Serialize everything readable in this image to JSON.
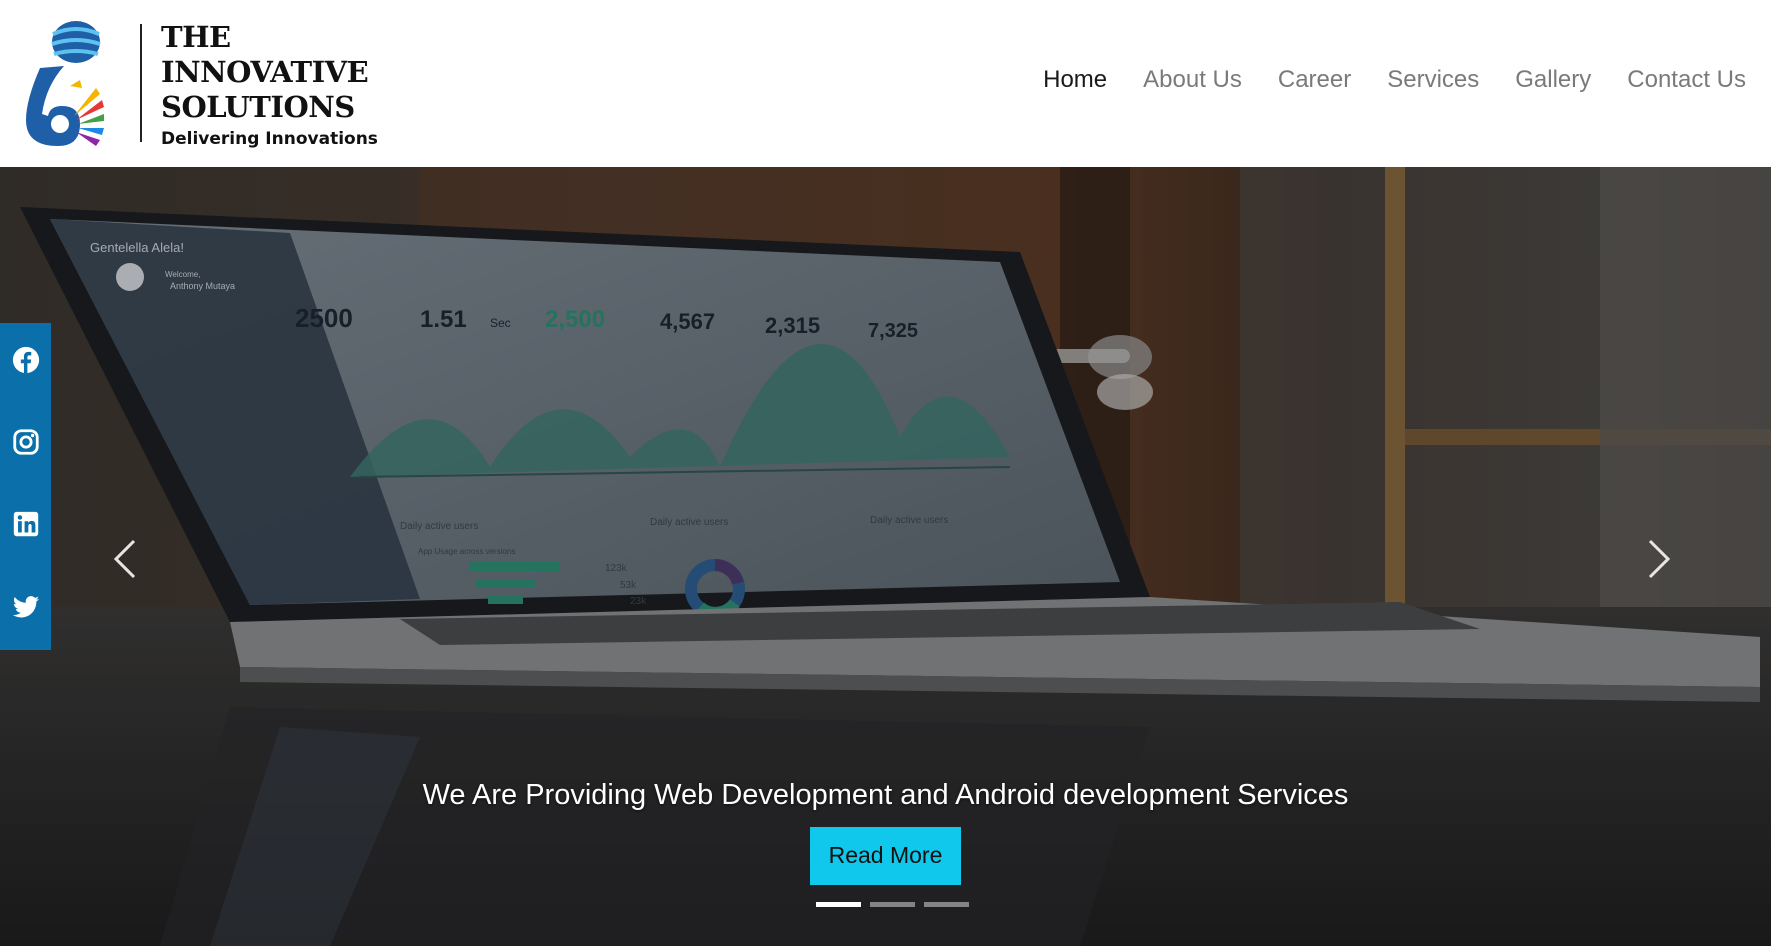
{
  "brand": {
    "name_lines": [
      "THE",
      "INNOVATIVE",
      "SOLUTIONS"
    ],
    "tagline": "Delivering Innovations",
    "logo_icon": "globe-peacock-logo-icon"
  },
  "nav": {
    "items": [
      {
        "label": "Home",
        "active": true
      },
      {
        "label": "About Us",
        "active": false
      },
      {
        "label": "Career",
        "active": false
      },
      {
        "label": "Services",
        "active": false
      },
      {
        "label": "Gallery",
        "active": false
      },
      {
        "label": "Contact Us",
        "active": false
      }
    ]
  },
  "hero": {
    "caption": "We Are Providing Web Development and Android development Services",
    "cta_label": "Read More",
    "slide_count": 3,
    "active_slide": 1,
    "prev_icon": "chevron-left-icon",
    "next_icon": "chevron-right-icon",
    "dashboard": {
      "brand": "Gentelella Alela!",
      "user_greeting": "Welcome,",
      "user_name": "Anthony Mutaya",
      "stats": [
        "2500",
        "1.51",
        "2,500",
        "4,567",
        "2,315",
        "7,325"
      ],
      "stat_unit": "Sec",
      "panel_titles": [
        "Daily active users",
        "Daily active users",
        "Daily active users"
      ],
      "app_usage_title": "App Usage across versions",
      "app_usage_values": [
        "123k",
        "53k",
        "23k"
      ]
    }
  },
  "social": {
    "items": [
      {
        "icon": "facebook-icon"
      },
      {
        "icon": "instagram-icon"
      },
      {
        "icon": "linkedin-icon"
      },
      {
        "icon": "twitter-icon"
      }
    ]
  },
  "colors": {
    "accent_cyan": "#10c7ec",
    "social_blue": "#0b6fa9",
    "nav_active": "#1a1a1a",
    "nav_inactive": "#7a7a7a"
  }
}
